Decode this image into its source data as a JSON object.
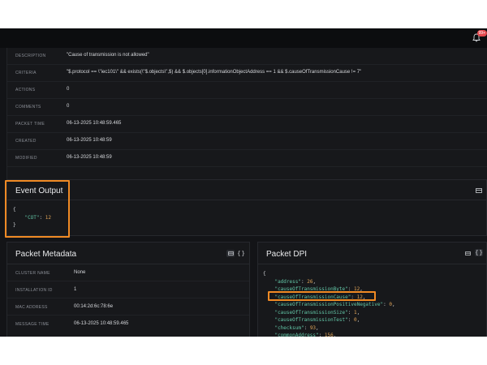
{
  "notifications": {
    "badge": "99+"
  },
  "details": [
    {
      "label": "DESCRIPTION",
      "value": "\"Cause of transmission is not allowed\""
    },
    {
      "label": "CRITERIA",
      "value": "\"$.protocol == \\\"iec101\\\" && exists(\\\"$.objects\\\",$) && $.objects[0].informationObjectAddress == 1 && $.causeOfTransmissionCause != 7\""
    },
    {
      "label": "ACTIONS",
      "value": "0"
    },
    {
      "label": "COMMENTS",
      "value": "0"
    },
    {
      "label": "PACKET TIME",
      "value": "06-13-2025 10:48:59.465"
    },
    {
      "label": "CREATED",
      "value": "06-13-2025 10:48:59"
    },
    {
      "label": "MODIFIED",
      "value": "06-13-2025 10:48:59"
    }
  ],
  "event_output": {
    "title": "Event Output",
    "open_brace": "{",
    "key": "\"COT\"",
    "colon": ":",
    "value": "12",
    "close_brace": "}"
  },
  "packet_metadata": {
    "title": "Packet Metadata",
    "rows": [
      {
        "label": "CLUSTER NAME",
        "value": "None"
      },
      {
        "label": "INSTALLATION ID",
        "value": "1"
      },
      {
        "label": "MAC ADDRESS",
        "value": "00:14:2d:6c:78:6e"
      },
      {
        "label": "MESSAGE TIME",
        "value": "06-13-2025 10:48:59.465"
      }
    ]
  },
  "packet_dpi": {
    "title": "Packet DPI",
    "open_brace": "{",
    "lines": [
      {
        "key": "\"address\"",
        "value": "26"
      },
      {
        "key": "\"causeOfTransmissionByte\"",
        "value": "12"
      },
      {
        "key": "\"causeOfTransmissionCause\"",
        "value": "12"
      },
      {
        "key": "\"causeOfTransmissionPositiveNegative\"",
        "value": "0"
      },
      {
        "key": "\"causeOfTransmissionSize\"",
        "value": "1"
      },
      {
        "key": "\"causeOfTransmissionTest\"",
        "value": "0"
      },
      {
        "key": "\"checksum\"",
        "value": "93"
      },
      {
        "key": "\"commonAddress\"",
        "value": "156"
      }
    ]
  },
  "colors": {
    "background": "#131417",
    "panel": "#17181b",
    "highlight": "#f08a24",
    "json_key": "#62c5a6",
    "json_number": "#e0a458"
  }
}
